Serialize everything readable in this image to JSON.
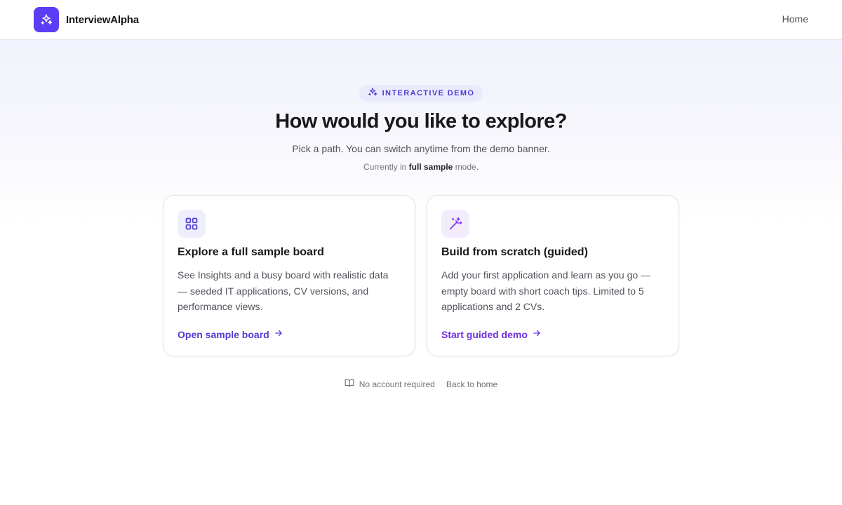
{
  "header": {
    "brand_name": "InterviewAlpha",
    "nav_home": "Home"
  },
  "hero": {
    "badge": "INTERACTIVE DEMO",
    "title": "How would you like to explore?",
    "subtitle": "Pick a path. You can switch anytime from the demo banner.",
    "mode_prefix": "Currently in",
    "mode_value": "full sample",
    "mode_suffix": "mode."
  },
  "cards": [
    {
      "icon": "grid-icon",
      "title": "Explore a full sample board",
      "description": "See Insights and a busy board with realistic data — seeded IT applications, CV versions, and performance views.",
      "link": "Open sample board",
      "accent": "#4f3bd6"
    },
    {
      "icon": "magic-wand-icon",
      "title": "Build from scratch (guided)",
      "description": "Add your first application and learn as you go — empty board with short coach tips. Limited to 5 applications and 2 CVs.",
      "link": "Start guided demo",
      "accent": "#6d2ee0"
    }
  ],
  "footer": {
    "no_account": "No account required",
    "back_home": "Back to home"
  },
  "colors": {
    "brand": "#5b3df5",
    "accent_indigo": "#4f3bd6",
    "accent_violet": "#6d2ee0"
  }
}
